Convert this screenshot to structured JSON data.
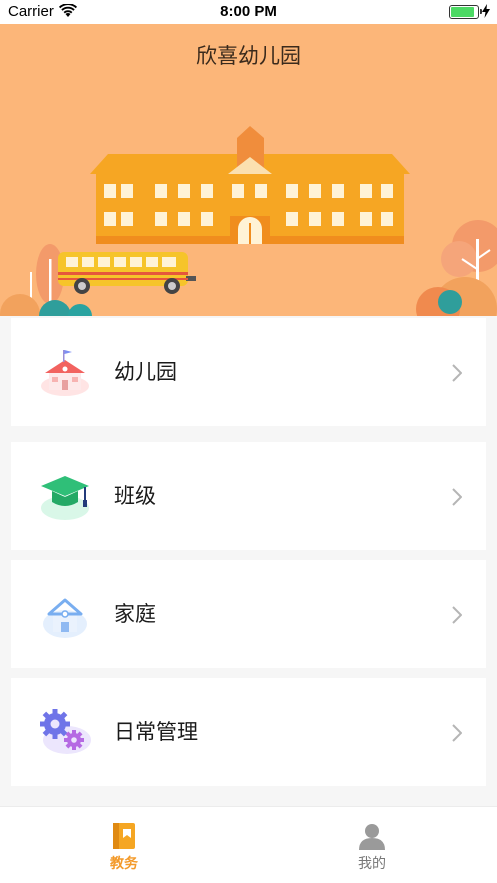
{
  "status_bar": {
    "carrier": "Carrier",
    "time": "8:00 PM"
  },
  "banner": {
    "title": "欣喜幼儿园"
  },
  "menu": {
    "items": [
      {
        "label": "幼儿园",
        "icon": "kindergarten-building-icon"
      },
      {
        "label": "班级",
        "icon": "graduation-cap-icon"
      },
      {
        "label": "家庭",
        "icon": "home-icon"
      },
      {
        "label": "日常管理",
        "icon": "gears-icon"
      }
    ]
  },
  "tab_bar": {
    "tabs": [
      {
        "label": "教务",
        "icon": "book-icon",
        "active": true
      },
      {
        "label": "我的",
        "icon": "user-icon",
        "active": false
      }
    ]
  },
  "colors": {
    "accent": "#f39a2a",
    "banner_bg": "#fcb679",
    "inactive": "#9a9a9a"
  }
}
